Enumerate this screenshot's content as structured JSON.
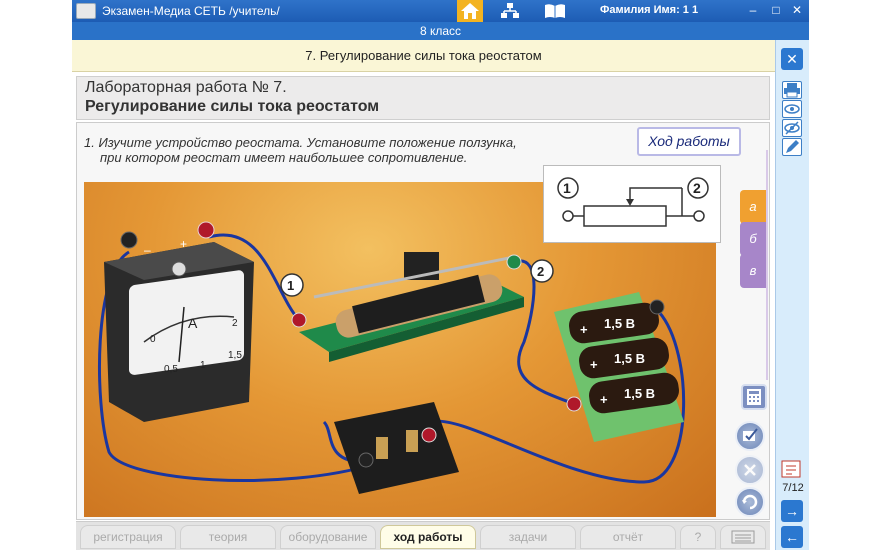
{
  "window": {
    "app_title": "Экзамен-Медиа СЕТЬ /учитель/",
    "student_name": "Фамилия Имя:  1 1",
    "minimize": "–",
    "maximize": "□",
    "close": "✕"
  },
  "grade": "8 класс",
  "lesson_title": "7. Регулирование силы тока реостатом",
  "heading": {
    "lab_number": "Лабораторная работа № 7.",
    "topic": "Регулирование силы тока реостатом"
  },
  "instruction": {
    "line1": "1. Изучите устройство реостата. Установите положение ползунка,",
    "line2": "при котором реостат имеет наибольшее сопротивление."
  },
  "work_button": "Ход работы",
  "scene": {
    "ammeter_unit": "A",
    "ammeter_scale": [
      "0",
      "0,5",
      "1",
      "1,5",
      "2"
    ],
    "minus": "–",
    "plus": "+",
    "terminal_1": "1",
    "terminal_2": "2",
    "battery_labels": [
      "1,5 В",
      "1,5 В",
      "1,5 В"
    ],
    "battery_plus": "+"
  },
  "schematic": {
    "terminal_1": "1",
    "terminal_2": "2"
  },
  "side_tabs": [
    "а",
    "б",
    "в"
  ],
  "page_counter": "7/12",
  "bottom_tabs": [
    {
      "label": "регистрация",
      "active": false
    },
    {
      "label": "теория",
      "active": false
    },
    {
      "label": "оборудование",
      "active": false
    },
    {
      "label": "ход работы",
      "active": true
    },
    {
      "label": "задачи",
      "active": false
    },
    {
      "label": "отчёт",
      "active": false
    }
  ],
  "help": "?",
  "colors": {
    "titlebar": "#2f73c9",
    "lesson_bar": "#faf6d6",
    "rail": "#d8ecfb",
    "tab_a": "#f0a030",
    "tab_b": "#a786c9",
    "tab_v": "#a786c9",
    "scene_bg": "#e49735"
  }
}
